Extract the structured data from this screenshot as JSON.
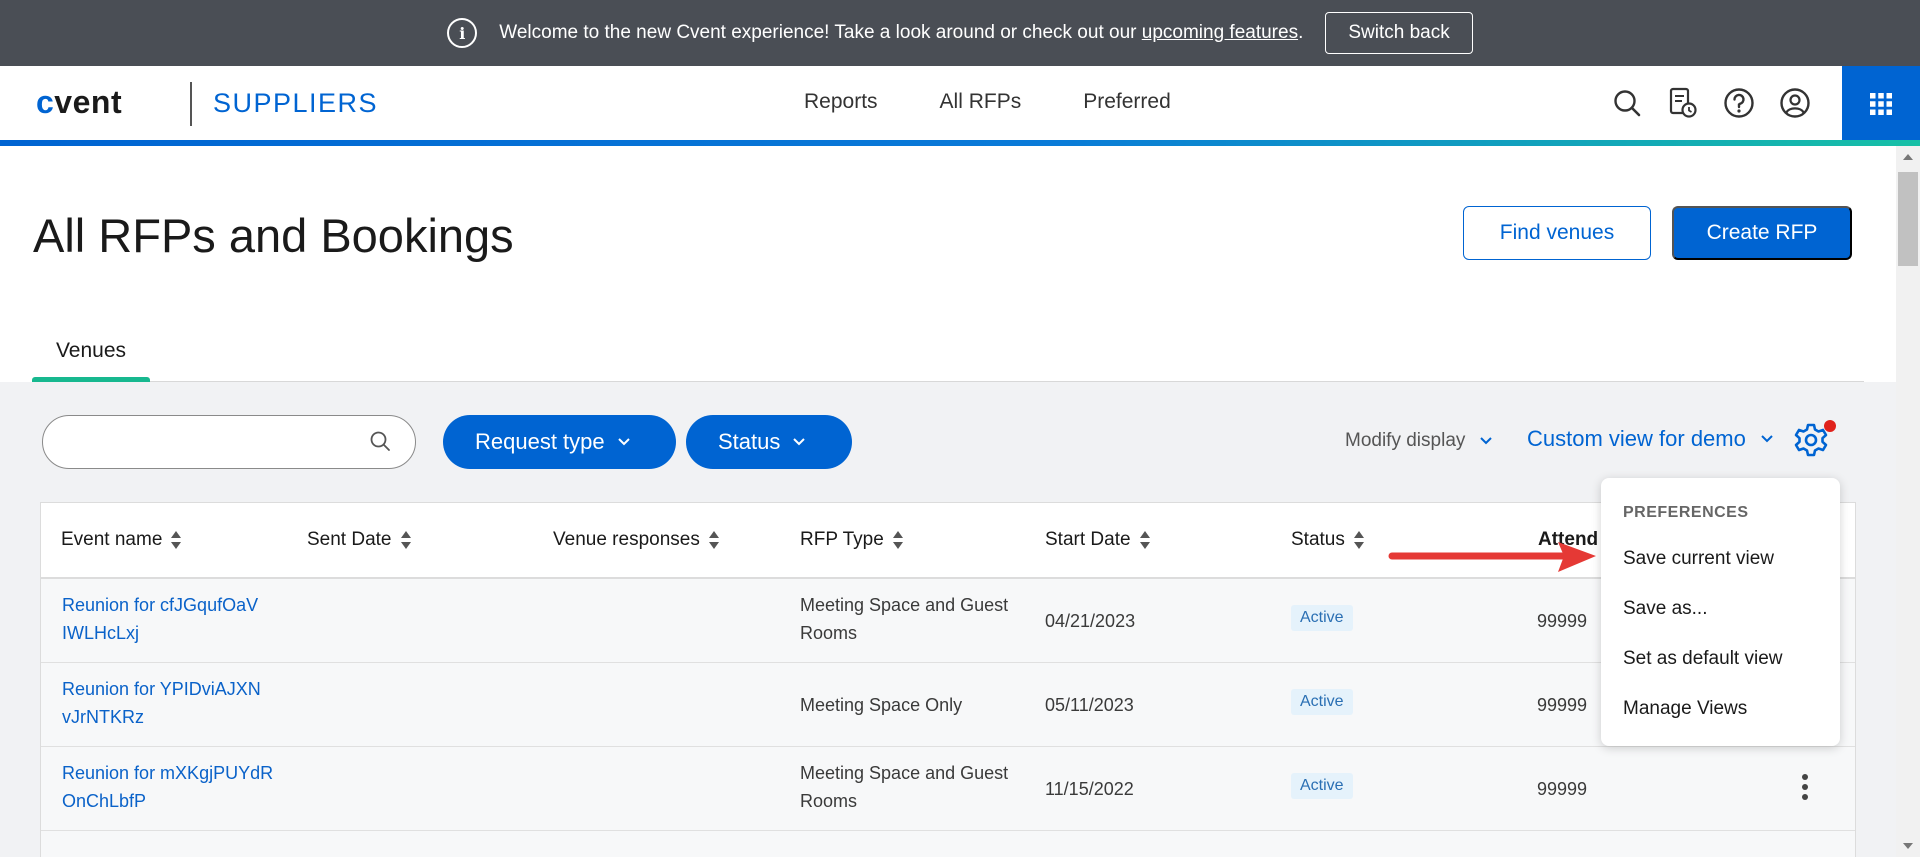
{
  "banner": {
    "message": "Welcome to the new Cvent experience! Take a look around or check out our ",
    "link": "upcoming features",
    "period": ".",
    "switch_back": "Switch back"
  },
  "header": {
    "logo_c": "c",
    "logo_rest": "vent",
    "product": "SUPPLIERS",
    "nav": [
      "Reports",
      "All RFPs",
      "Preferred"
    ]
  },
  "page": {
    "title": "All RFPs and Bookings",
    "find_venues": "Find venues",
    "create_rfp": "Create RFP",
    "tab": "Venues"
  },
  "filters": {
    "search_placeholder": "",
    "request_type": "Request type",
    "status": "Status",
    "modify_display": "Modify display",
    "custom_view": "Custom view for demo"
  },
  "table": {
    "columns": [
      "Event name",
      "Sent Date",
      "Venue responses",
      "RFP Type",
      "Start Date",
      "Status",
      "Attend"
    ],
    "rows": [
      {
        "event_1": "Reunion for cfJGqufOaV",
        "event_2": "IWLHcLxj",
        "rfp_1": "Meeting Space and Guest",
        "rfp_2": "Rooms",
        "start": "04/21/2023",
        "status": "Active",
        "attend": "99999"
      },
      {
        "event_1": "Reunion for YPIDviAJXN",
        "event_2": "vJrNTKRz",
        "rfp_1": "Meeting Space Only",
        "rfp_2": "",
        "start": "05/11/2023",
        "status": "Active",
        "attend": "99999"
      },
      {
        "event_1": "Reunion for mXKgjPUYdR",
        "event_2": "OnChLbfP",
        "rfp_1": "Meeting Space and Guest",
        "rfp_2": "Rooms",
        "start": "11/15/2022",
        "status": "Active",
        "attend": "99999"
      }
    ]
  },
  "menu": {
    "title": "PREFERENCES",
    "items": [
      "Save current view",
      "Save as...",
      "Set as default view",
      "Manage Views"
    ]
  },
  "colors": {
    "brand": "#0064d2",
    "banner": "#4a4e55",
    "accent_green": "#17b88f",
    "notify_red": "#e0221c",
    "arrow_red": "#e53935"
  }
}
